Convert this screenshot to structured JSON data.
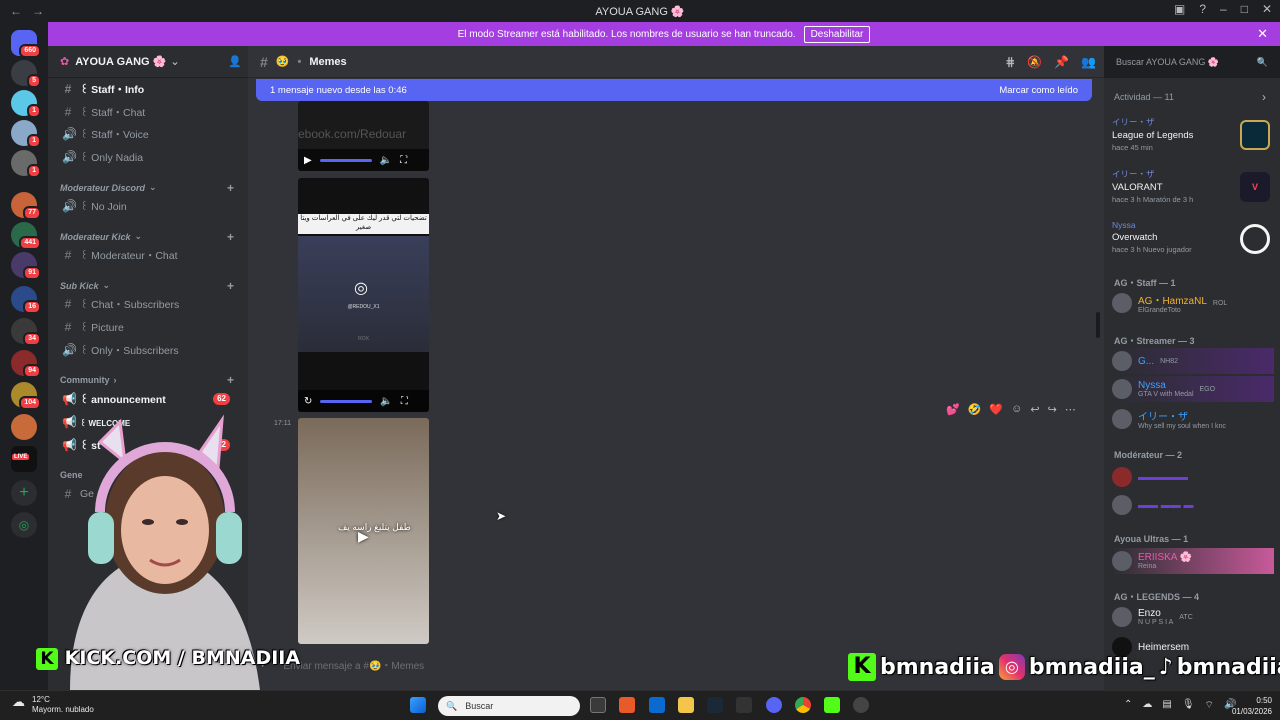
{
  "titlebar": {
    "title": "AYOUA GANG 🌸"
  },
  "banner": {
    "text": "El modo Streamer está habilitado. Los nombres de usuario se han truncado.",
    "button": "Deshabilitar"
  },
  "rail": {
    "badges": [
      "660",
      "5",
      "1",
      "1",
      "1",
      "77",
      "441",
      "91",
      "16",
      "34",
      "94",
      "104",
      "LIVE"
    ]
  },
  "server": {
    "name": "AYOUA GANG 🌸"
  },
  "channels": [
    {
      "label": "꒰ Staff・Info",
      "icon": "#"
    },
    {
      "label": "꒰ Staff・Chat",
      "icon": "#"
    },
    {
      "label": "꒰ Staff・Voice",
      "icon": "🔊"
    },
    {
      "label": "꒰ Only Nadia",
      "icon": "🔊"
    },
    {
      "label": "꒰ No Join",
      "icon": "🔊"
    },
    {
      "label": "꒰ Moderateur・Chat",
      "icon": "#"
    },
    {
      "label": "꒰ Chat・Subscribers",
      "icon": "#"
    },
    {
      "label": "꒰ Picture",
      "icon": "#"
    },
    {
      "label": "꒰ Only・Subscribers",
      "icon": "🔊"
    },
    {
      "label": "꒰ announcement",
      "icon": "📢",
      "badge": "62"
    },
    {
      "label": "꒰ WELCOME",
      "icon": "📢"
    },
    {
      "label": "꒰ st",
      "icon": "📢",
      "badge": "12"
    },
    {
      "label": "Ge",
      "icon": "#"
    }
  ],
  "categories": [
    "Moderateur Discord",
    "Moderateur Kick",
    "Sub Kick",
    "Community",
    "Gene"
  ],
  "header": {
    "channel": "Memes",
    "search_placeholder": "Buscar AYOUA GANG 🌸"
  },
  "newmsg": {
    "text": "1 mensaje nuevo desde las 0:46",
    "action": "Marcar como leído"
  },
  "chat": {
    "timestamp": "17:11",
    "watermark": "ebook.com/Redouar",
    "video2_caption": "تضحيات لتي قدر ليك على في العراسات ويتا صغير",
    "video2_handle": "@REDOU_X1",
    "video2_footer": "ROX",
    "video3_caption": "طفل يتلبغ راسه يف"
  },
  "composer": {
    "placeholder": "Enviar mensaje a #🥹・Memes"
  },
  "activity": {
    "header": "Actividad — 11",
    "items": [
      {
        "who": "イリー・ザ",
        "game": "League of Legends",
        "meta": "hace 45 min"
      },
      {
        "who": "イリー・ザ",
        "game": "VALORANT",
        "meta": "hace 3 h   Maratón de 3 h"
      },
      {
        "who": "Nyssa",
        "game": "Overwatch",
        "meta": "hace 3 h   Nuevo jugador"
      }
    ]
  },
  "groups": [
    {
      "label": "AG・Staff — 1",
      "members": [
        {
          "name": "AG・HamzaNL",
          "tag": "ROL",
          "sub": "ElGrandeToto",
          "color": "#f0b232"
        }
      ]
    },
    {
      "label": "AG・Streamer — 3",
      "members": [
        {
          "name": "G...",
          "tag": "NH82",
          "sub": "",
          "color": "#3ba3ff"
        },
        {
          "name": "Nyssa",
          "tag": "EGO",
          "sub": "GTA V with Medal",
          "color": "#3ba3ff"
        },
        {
          "name": "イリー・ザ",
          "tag": "",
          "sub": "Why sell my soul when I knc",
          "color": "#3ba3ff"
        }
      ]
    },
    {
      "label": "Modérateur — 2",
      "members": [
        {
          "name": "",
          "tag": "",
          "sub": "",
          "color": "#6c3fd8"
        },
        {
          "name": "",
          "tag": "",
          "sub": "",
          "color": "#6c3fd8"
        }
      ]
    },
    {
      "label": "Ayoua Ultras — 1",
      "members": [
        {
          "name": "ERIISKA 🌸",
          "tag": "",
          "sub": "Reina",
          "color": "#e85ba8"
        }
      ]
    },
    {
      "label": "AG・LEGENDS — 4",
      "members": [
        {
          "name": "Enzo",
          "tag": "ATC",
          "sub": "N U P S I A",
          "color": "#f2f3f5"
        },
        {
          "name": "Heimersem",
          "tag": "",
          "sub": "",
          "color": "#f2f3f5"
        }
      ]
    }
  ],
  "overlays": {
    "kick": "KICK.COM / BMNADIIA",
    "social1": "bmnadiia",
    "social2": "bmnadiia_",
    "social3": "bmnadiia"
  },
  "taskbar": {
    "temp": "12°C",
    "weather": "Mayorm. nublado",
    "search": "Buscar",
    "time": "0:50",
    "date": "01/03/2026"
  },
  "colors": {
    "accent": "#5865f2",
    "banner": "#a43ee1",
    "kick": "#53fc18"
  }
}
